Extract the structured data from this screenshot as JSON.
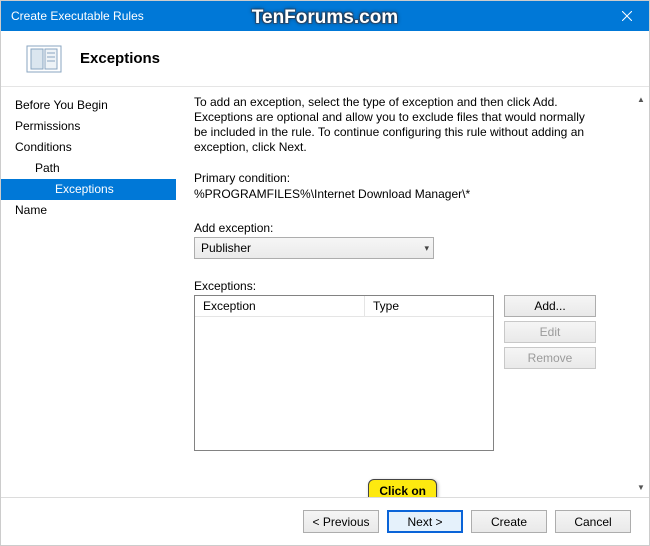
{
  "titlebar": {
    "text": "Create Executable Rules"
  },
  "watermark": "TenForums.com",
  "header": {
    "title": "Exceptions"
  },
  "nav": {
    "items": [
      {
        "label": "Before You Begin",
        "indent": 0
      },
      {
        "label": "Permissions",
        "indent": 0
      },
      {
        "label": "Conditions",
        "indent": 0
      },
      {
        "label": "Path",
        "indent": 1
      },
      {
        "label": "Exceptions",
        "indent": 2,
        "selected": true
      },
      {
        "label": "Name",
        "indent": 0
      }
    ]
  },
  "content": {
    "description": "To add an exception, select the type of exception and then click Add. Exceptions are optional and allow you to exclude files that would normally be included in the rule. To continue configuring this rule without adding an exception, click Next.",
    "primary_label": "Primary condition:",
    "primary_value": "%PROGRAMFILES%\\Internet Download Manager\\*",
    "add_label": "Add exception:",
    "combo_value": "Publisher",
    "exceptions_label": "Exceptions:",
    "table_headers": {
      "col1": "Exception",
      "col2": "Type"
    },
    "buttons": {
      "add": "Add...",
      "edit": "Edit",
      "remove": "Remove"
    }
  },
  "footer": {
    "previous": "< Previous",
    "next": "Next >",
    "create": "Create",
    "cancel": "Cancel"
  },
  "callout": {
    "text": "Click on"
  }
}
